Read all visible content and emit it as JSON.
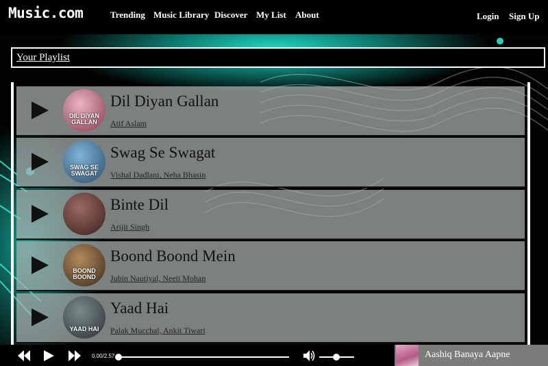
{
  "nav": {
    "logo": "Music.com",
    "links": [
      "Trending",
      "Music Library",
      "Discover",
      "My List",
      "About"
    ],
    "login": "Login",
    "signup": "Sign Up"
  },
  "playlist": {
    "heading": "Your Playlist",
    "tracks": [
      {
        "title": "Dil Diyan Gallan",
        "artist": "Atif Aslam",
        "thumb_text": "DIL DIYAN GALLAN",
        "thumb_colors": [
          "#e9b6c0",
          "#8b3a4f"
        ]
      },
      {
        "title": "Swag Se Swagat",
        "artist": "Vishal Dadlani, Neha Bhasin",
        "thumb_text": "SWAG SE SWAGAT",
        "thumb_colors": [
          "#7fb4d8",
          "#2a4d6e"
        ]
      },
      {
        "title": "Binte Dil",
        "artist": "Arijit Singh",
        "thumb_text": "",
        "thumb_colors": [
          "#9a6a62",
          "#3d1f1c"
        ]
      },
      {
        "title": "Boond Boond Mein",
        "artist": "Jubin Nautiyal, Neeti Mohan",
        "thumb_text": "BOOND BOOND",
        "thumb_colors": [
          "#b48a5c",
          "#3b2a1b"
        ]
      },
      {
        "title": "Yaad Hai",
        "artist": "Palak Mucchal, Ankit Tiwari",
        "thumb_text": "YAAD HAI",
        "thumb_colors": [
          "#7a8c8a",
          "#2c2f35"
        ]
      }
    ]
  },
  "player": {
    "time": "0.00/2.57",
    "progress": 0,
    "volume": 0.5,
    "now_playing": "Aashiq Banaya Aapne",
    "icons": [
      "previous-icon",
      "play-icon",
      "next-icon",
      "volume-icon"
    ]
  }
}
